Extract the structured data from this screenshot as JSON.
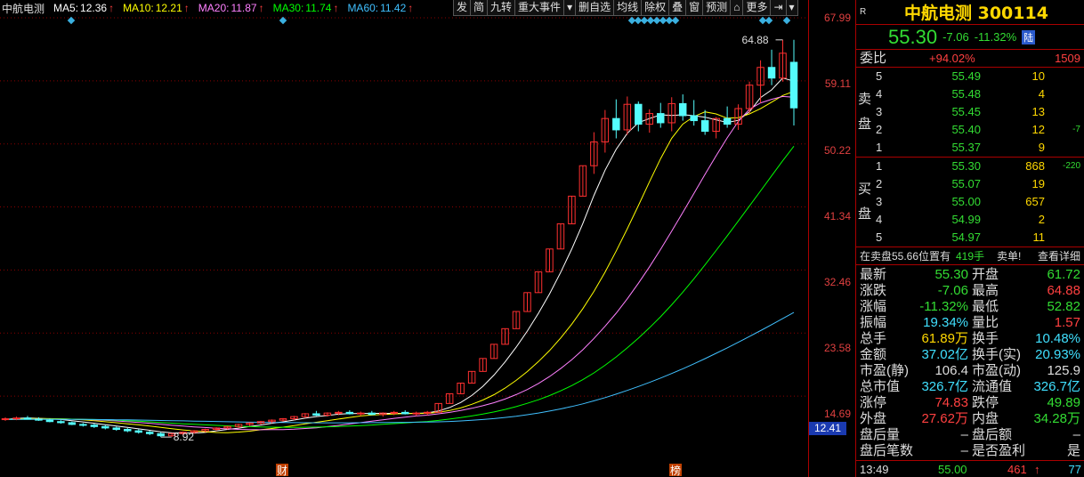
{
  "chart_header": {
    "stock_name": "中航电测",
    "ma": [
      {
        "label": "MA5:",
        "value": "12.36",
        "arrow": "↑",
        "color": "#ffffff"
      },
      {
        "label": "MA10:",
        "value": "12.21",
        "arrow": "↑",
        "color": "#ffff00"
      },
      {
        "label": "MA20:",
        "value": "11.87",
        "arrow": "↑",
        "color": "#ff80ff"
      },
      {
        "label": "MA30:",
        "value": "11.74",
        "arrow": "↑",
        "color": "#00ff00"
      },
      {
        "label": "MA60:",
        "value": "11.42",
        "arrow": "↑",
        "color": "#40c0ff"
      }
    ]
  },
  "toolbar": [
    "发",
    "简",
    "九转",
    "重大事件",
    "▾",
    "删自选",
    "均线",
    "除权",
    "叠",
    "窗",
    "预测",
    "⌂",
    "更多",
    "⇥",
    "▾"
  ],
  "price_axis": {
    "ticks": [
      "67.99",
      "59.11",
      "50.22",
      "41.34",
      "32.46",
      "23.58",
      "14.69"
    ],
    "last_price": "12.41"
  },
  "annotations": {
    "high_label": "64.88",
    "low_label": "8.92",
    "marker_cai": "财",
    "marker_bang": "榜"
  },
  "chart_data": {
    "type": "candlestick",
    "ylim": [
      5.8,
      67.99
    ],
    "yticks": [
      67.99,
      59.11,
      50.22,
      41.34,
      32.46,
      23.58,
      14.69
    ],
    "candles": [
      [
        11.4,
        11.7,
        11.2,
        11.5
      ],
      [
        11.5,
        11.8,
        11.3,
        11.6
      ],
      [
        11.6,
        11.9,
        11.4,
        11.45
      ],
      [
        11.45,
        11.7,
        11.2,
        11.3
      ],
      [
        11.3,
        11.5,
        11.0,
        11.1
      ],
      [
        11.1,
        11.3,
        10.8,
        10.95
      ],
      [
        10.95,
        11.1,
        10.6,
        10.7
      ],
      [
        10.7,
        10.9,
        10.4,
        10.6
      ],
      [
        10.6,
        10.8,
        10.2,
        10.4
      ],
      [
        10.4,
        10.6,
        10.0,
        10.2
      ],
      [
        10.2,
        10.4,
        9.8,
        10.0
      ],
      [
        10.0,
        10.2,
        9.6,
        9.8
      ],
      [
        9.8,
        10.0,
        9.4,
        9.6
      ],
      [
        9.6,
        9.8,
        9.2,
        9.4
      ],
      [
        9.4,
        9.6,
        8.92,
        9.1
      ],
      [
        9.1,
        9.5,
        8.95,
        9.4
      ],
      [
        9.4,
        9.7,
        9.2,
        9.6
      ],
      [
        9.6,
        9.9,
        9.4,
        9.8
      ],
      [
        9.8,
        10.1,
        9.6,
        10.0
      ],
      [
        10.0,
        10.3,
        9.8,
        10.2
      ],
      [
        10.2,
        10.5,
        10.0,
        10.4
      ],
      [
        10.4,
        10.8,
        10.2,
        10.7
      ],
      [
        10.7,
        11.0,
        10.5,
        10.9
      ],
      [
        10.9,
        11.2,
        10.7,
        11.1
      ],
      [
        11.1,
        11.4,
        10.9,
        11.3
      ],
      [
        11.3,
        11.6,
        11.1,
        11.5
      ],
      [
        11.5,
        11.9,
        11.3,
        11.8
      ],
      [
        11.8,
        12.3,
        11.6,
        12.2
      ],
      [
        12.2,
        12.6,
        11.9,
        12.0
      ],
      [
        12.0,
        12.4,
        11.8,
        12.3
      ],
      [
        12.3,
        12.6,
        12.0,
        12.4
      ],
      [
        12.4,
        12.7,
        12.1,
        12.2
      ],
      [
        12.2,
        12.5,
        11.9,
        12.3
      ],
      [
        12.3,
        12.6,
        12.0,
        12.1
      ],
      [
        12.1,
        12.4,
        11.8,
        12.3
      ],
      [
        12.3,
        12.6,
        12.0,
        12.4
      ],
      [
        12.4,
        12.7,
        12.1,
        12.2
      ],
      [
        12.2,
        12.5,
        11.9,
        12.3
      ],
      [
        12.3,
        12.6,
        12.0,
        12.41
      ],
      [
        12.41,
        13.65,
        12.41,
        13.65
      ],
      [
        13.65,
        15.02,
        13.65,
        15.02
      ],
      [
        15.02,
        16.52,
        15.02,
        16.52
      ],
      [
        16.52,
        18.17,
        16.52,
        18.17
      ],
      [
        18.17,
        19.99,
        18.17,
        19.99
      ],
      [
        19.99,
        21.99,
        19.99,
        21.99
      ],
      [
        21.99,
        24.19,
        21.99,
        24.19
      ],
      [
        24.19,
        26.61,
        24.19,
        26.61
      ],
      [
        26.61,
        29.27,
        26.61,
        29.27
      ],
      [
        29.27,
        32.2,
        29.27,
        32.2
      ],
      [
        32.2,
        35.42,
        32.2,
        35.42
      ],
      [
        35.42,
        38.96,
        35.42,
        38.96
      ],
      [
        38.96,
        42.86,
        38.96,
        42.86
      ],
      [
        42.86,
        47.15,
        42.86,
        47.15
      ],
      [
        47.15,
        51.87,
        46.0,
        50.5
      ],
      [
        50.5,
        55.0,
        49.0,
        53.8
      ],
      [
        53.8,
        56.5,
        51.0,
        52.2
      ],
      [
        52.2,
        56.9,
        51.5,
        55.8
      ],
      [
        55.8,
        56.2,
        52.0,
        53.0
      ],
      [
        53.0,
        55.1,
        51.8,
        54.5
      ],
      [
        54.5,
        56.0,
        52.5,
        53.2
      ],
      [
        53.2,
        56.8,
        52.0,
        55.9
      ],
      [
        55.9,
        57.2,
        53.5,
        54.2
      ],
      [
        54.2,
        56.4,
        52.8,
        53.5
      ],
      [
        53.5,
        55.0,
        51.5,
        52.0
      ],
      [
        52.0,
        54.0,
        51.0,
        53.8
      ],
      [
        53.8,
        55.5,
        52.5,
        53.0
      ],
      [
        53.0,
        55.8,
        52.2,
        55.2
      ],
      [
        55.2,
        59.0,
        54.5,
        58.5
      ],
      [
        58.5,
        62.0,
        56.0,
        61.0
      ],
      [
        61.0,
        63.5,
        58.5,
        59.5
      ],
      [
        59.5,
        64.88,
        59.0,
        63.0
      ],
      [
        61.72,
        64.88,
        52.82,
        55.3
      ]
    ],
    "ma_series": [
      {
        "name": "MA5",
        "values": [
          11.42,
          11.55,
          11.62,
          11.55,
          11.49,
          11.39,
          11.23,
          11.05,
          10.86,
          10.67,
          10.48,
          10.28,
          10.08,
          9.88,
          9.66,
          9.51,
          9.48,
          9.48,
          9.58,
          9.8,
          10.0,
          10.18,
          10.4,
          10.62,
          10.86,
          11.06,
          11.32,
          11.58,
          11.8,
          11.96,
          12.14,
          12.22,
          12.24,
          12.26,
          12.26,
          12.26,
          12.26,
          12.26,
          12.32,
          12.6,
          13.08,
          13.79,
          14.78,
          16.07,
          17.66,
          19.51,
          21.58,
          23.86,
          26.36,
          29.1,
          32.1,
          35.4,
          39.02,
          42.98,
          46.52,
          49.44,
          51.72,
          53.22,
          53.8,
          54.32,
          54.22,
          54.34,
          54.2,
          53.98,
          53.62,
          53.24,
          53.54,
          54.75,
          56.76,
          57.84,
          59.5,
          59.06
        ]
      },
      {
        "name": "MA10",
        "values": [
          11.4,
          11.45,
          11.52,
          11.54,
          11.52,
          11.49,
          11.44,
          11.35,
          11.23,
          11.08,
          10.94,
          10.79,
          10.64,
          10.47,
          10.27,
          10.09,
          9.93,
          9.78,
          9.67,
          9.56,
          9.54,
          9.62,
          9.75,
          9.95,
          10.12,
          10.32,
          10.54,
          10.79,
          11.0,
          11.22,
          11.45,
          11.68,
          11.89,
          12.02,
          12.11,
          12.18,
          12.23,
          12.25,
          12.26,
          12.42,
          12.66,
          13.02,
          13.53,
          14.14,
          14.89,
          15.82,
          16.91,
          18.15,
          19.55,
          21.11,
          22.86,
          24.82,
          27.01,
          29.45,
          32.17,
          35.12,
          38.26,
          41.54,
          44.9,
          48.15,
          51.01,
          53.01,
          54.09,
          54.74,
          54.45,
          53.85,
          53.92,
          54.45,
          55.19,
          56.1,
          57.05,
          57.63
        ]
      },
      {
        "name": "MA20",
        "values": [
          11.4,
          11.42,
          11.45,
          11.47,
          11.47,
          11.46,
          11.44,
          11.4,
          11.35,
          11.28,
          11.19,
          11.08,
          10.98,
          10.86,
          10.72,
          10.58,
          10.46,
          10.35,
          10.26,
          10.16,
          10.07,
          10.0,
          9.96,
          9.95,
          9.96,
          9.98,
          10.03,
          10.12,
          10.23,
          10.39,
          10.57,
          10.76,
          10.95,
          11.17,
          11.36,
          11.55,
          11.73,
          11.89,
          12.01,
          12.19,
          12.4,
          12.66,
          12.97,
          13.33,
          13.76,
          14.28,
          14.9,
          15.62,
          16.47,
          17.45,
          18.56,
          19.8,
          21.22,
          22.82,
          24.53,
          26.36,
          28.39,
          30.59,
          32.91,
          35.38,
          37.94,
          40.56,
          43.24,
          45.94,
          48.54,
          51.08,
          53.39,
          55.1,
          56.0,
          56.5,
          56.9,
          56.8
        ]
      },
      {
        "name": "MA30",
        "values": [
          11.4,
          11.41,
          11.43,
          11.44,
          11.45,
          11.45,
          11.44,
          11.42,
          11.39,
          11.35,
          11.3,
          11.23,
          11.16,
          11.07,
          10.98,
          10.88,
          10.79,
          10.71,
          10.64,
          10.57,
          10.5,
          10.44,
          10.39,
          10.35,
          10.32,
          10.3,
          10.29,
          10.3,
          10.33,
          10.36,
          10.41,
          10.46,
          10.53,
          10.61,
          10.71,
          10.81,
          10.91,
          11.01,
          11.12,
          11.27,
          11.45,
          11.65,
          11.89,
          12.16,
          12.46,
          12.81,
          13.21,
          13.67,
          14.18,
          14.77,
          15.43,
          16.17,
          17.01,
          17.96,
          19.04,
          20.21,
          21.48,
          22.85,
          24.32,
          25.88,
          27.55,
          29.33,
          31.21,
          33.18,
          35.2,
          37.26,
          39.36,
          41.48,
          43.6,
          45.72,
          47.85,
          49.9
        ]
      },
      {
        "name": "MA60",
        "values": [
          11.4,
          11.4,
          11.41,
          11.41,
          11.41,
          11.41,
          11.41,
          11.4,
          11.39,
          11.38,
          11.36,
          11.34,
          11.32,
          11.29,
          11.26,
          11.23,
          11.2,
          11.17,
          11.14,
          11.11,
          11.08,
          11.05,
          11.02,
          11.0,
          10.98,
          10.96,
          10.95,
          10.94,
          10.93,
          10.93,
          10.93,
          10.93,
          10.94,
          10.95,
          10.96,
          10.97,
          10.99,
          11.01,
          11.03,
          11.07,
          11.12,
          11.19,
          11.28,
          11.39,
          11.52,
          11.68,
          11.86,
          12.07,
          12.31,
          12.58,
          12.88,
          13.22,
          13.6,
          14.02,
          14.48,
          14.97,
          15.49,
          16.04,
          16.62,
          17.23,
          17.87,
          18.54,
          19.24,
          19.97,
          20.72,
          21.49,
          22.28,
          23.09,
          23.92,
          24.76,
          25.62,
          26.48
        ]
      }
    ]
  },
  "panel": {
    "r_mark": "R",
    "name_code": "中航电测 300114",
    "price": "55.30",
    "change": "-7.06",
    "change_pct": "-11.32%",
    "board_tag": "陆",
    "weibi_label": "委比",
    "weibi_value": "+94.02%",
    "weibi_diff": "1509",
    "sell_label": "卖盘",
    "buy_label": "买盘",
    "sell": [
      {
        "lvl": "5",
        "price": "55.49",
        "vol": "10",
        "chg": ""
      },
      {
        "lvl": "4",
        "price": "55.48",
        "vol": "4",
        "chg": ""
      },
      {
        "lvl": "3",
        "price": "55.45",
        "vol": "13",
        "chg": ""
      },
      {
        "lvl": "2",
        "price": "55.40",
        "vol": "12",
        "chg": "-7"
      },
      {
        "lvl": "1",
        "price": "55.37",
        "vol": "9",
        "chg": ""
      }
    ],
    "buy": [
      {
        "lvl": "1",
        "price": "55.30",
        "vol": "868",
        "chg": "-220"
      },
      {
        "lvl": "2",
        "price": "55.07",
        "vol": "19",
        "chg": ""
      },
      {
        "lvl": "3",
        "price": "55.00",
        "vol": "657",
        "chg": ""
      },
      {
        "lvl": "4",
        "price": "54.99",
        "vol": "2",
        "chg": ""
      },
      {
        "lvl": "5",
        "price": "54.97",
        "vol": "11",
        "chg": ""
      }
    ],
    "info_line": {
      "text": "在卖盘55.66位置有",
      "qty": "419手",
      "sell_single": "卖单!",
      "detail_link": "查看详细"
    },
    "stats": [
      {
        "l1": "最新",
        "v1": "55.30",
        "c1": "#33dd33",
        "l2": "开盘",
        "v2": "61.72",
        "c2": "#33dd33"
      },
      {
        "l1": "涨跌",
        "v1": "-7.06",
        "c1": "#33dd33",
        "l2": "最高",
        "v2": "64.88",
        "c2": "#ff4040"
      },
      {
        "l1": "涨幅",
        "v1": "-11.32%",
        "c1": "#33dd33",
        "l2": "最低",
        "v2": "52.82",
        "c2": "#33dd33"
      },
      {
        "l1": "振幅",
        "v1": "19.34%",
        "c1": "#40e0ff",
        "l2": "量比",
        "v2": "1.57",
        "c2": "#ff4040"
      },
      {
        "l1": "总手",
        "v1": "61.89万",
        "c1": "#ffd800",
        "l2": "换手",
        "v2": "10.48%",
        "c2": "#40e0ff"
      },
      {
        "l1": "金额",
        "v1": "37.02亿",
        "c1": "#40e0ff",
        "l2": "换手(实)",
        "v2": "20.93%",
        "c2": "#40e0ff"
      },
      {
        "l1": "市盈(静)",
        "v1": "106.4",
        "c1": "#dddddd",
        "l2": "市盈(动)",
        "v2": "125.9",
        "c2": "#dddddd"
      },
      {
        "l1": "总市值",
        "v1": "326.7亿",
        "c1": "#40e0ff",
        "l2": "流通值",
        "v2": "326.7亿",
        "c2": "#40e0ff"
      },
      {
        "l1": "涨停",
        "v1": "74.83",
        "c1": "#ff4040",
        "l2": "跌停",
        "v2": "49.89",
        "c2": "#33dd33"
      },
      {
        "l1": "外盘",
        "v1": "27.62万",
        "c1": "#ff4040",
        "l2": "内盘",
        "v2": "34.28万",
        "c2": "#33dd33"
      },
      {
        "l1": "盘后量",
        "v1": "–",
        "c1": "#dddddd",
        "l2": "盘后额",
        "v2": "–",
        "c2": "#dddddd"
      },
      {
        "l1": "盘后笔数",
        "v1": "–",
        "c1": "#dddddd",
        "l2": "是否盈利",
        "v2": "是",
        "c2": "#dddddd"
      }
    ],
    "bottom": {
      "time": "13:49",
      "price": "55.00",
      "vol": "461",
      "arrow": "↑",
      "count": "77"
    }
  }
}
